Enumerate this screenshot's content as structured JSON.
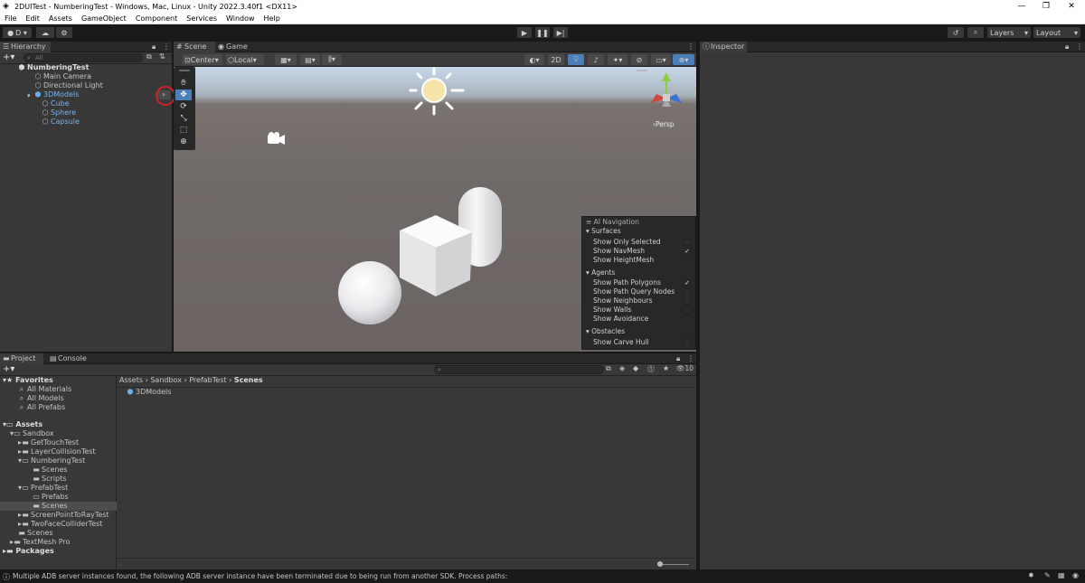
{
  "window": {
    "title": "2DUITest - NumberingTest - Windows, Mac, Linux - Unity 2022.3.40f1 <DX11>",
    "controls": [
      "—",
      "❐",
      "✕"
    ]
  },
  "menu": [
    "File",
    "Edit",
    "Assets",
    "GameObject",
    "Component",
    "Services",
    "Window",
    "Help"
  ],
  "toolbar": {
    "account": "D ▾",
    "layers": "Layers",
    "layout": "Layout"
  },
  "hierarchy": {
    "tab": "Hierarchy",
    "search_placeholder": "All",
    "items": [
      {
        "label": "NumberingTest"
      },
      {
        "label": "Main Camera"
      },
      {
        "label": "Directional Light"
      },
      {
        "label": "3DModels"
      },
      {
        "label": "Cube"
      },
      {
        "label": "Sphere"
      },
      {
        "label": "Capsule"
      }
    ]
  },
  "scene": {
    "tabs": [
      "Scene",
      "Game"
    ],
    "pivot": "Center",
    "space": "Local",
    "mode_2d": "2D",
    "persp": "Persp"
  },
  "ai_nav": {
    "title": "AI Navigation",
    "surfaces": "Surfaces",
    "show_only_selected": "Show Only Selected",
    "show_navmesh": "Show NavMesh",
    "show_heightmesh": "Show HeightMesh",
    "agents": "Agents",
    "show_path_polygons": "Show Path Polygons",
    "show_path_query_nodes": "Show Path Query Nodes",
    "show_neighbours": "Show Neighbours",
    "show_walls": "Show Walls",
    "show_avoidance": "Show Avoidance",
    "obstacles": "Obstacles",
    "show_carve_hull": "Show Carve Hull",
    "checked": [
      "Show NavMesh",
      "Show Path Polygons"
    ]
  },
  "inspector": {
    "tab": "Inspector"
  },
  "project": {
    "tabs": [
      "Project",
      "Console"
    ],
    "hidden_count": "10",
    "favorites": "Favorites",
    "fav_items": [
      "All Materials",
      "All Models",
      "All Prefabs"
    ],
    "assets": "Assets",
    "tree": [
      "Sandbox",
      "GetTouchTest",
      "LayerCollisionTest",
      "NumberingTest",
      "Scenes",
      "Scripts",
      "PrefabTest",
      "Prefabs",
      "Scenes",
      "ScreenPointToRayTest",
      "TwoFaceColliderTest",
      "Scenes",
      "TextMesh Pro",
      "Packages"
    ],
    "breadcrumb": [
      "Assets",
      "Sandbox",
      "PrefabTest",
      "Scenes"
    ],
    "files": [
      "3DModels"
    ]
  },
  "status": {
    "message": "Multiple ADB server instances found, the following ADB server instance have been terminated due to being run from another SDK. Process paths:"
  }
}
